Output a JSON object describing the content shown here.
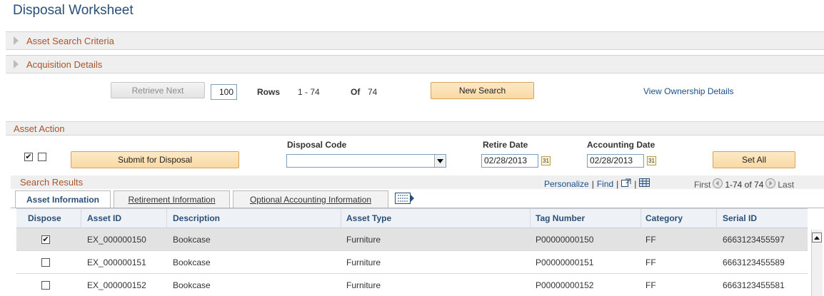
{
  "page": {
    "title": "Disposal Worksheet"
  },
  "sections": {
    "asset_search_criteria": "Asset Search Criteria",
    "acquisition_details": "Acquisition Details",
    "asset_action": "Asset Action"
  },
  "nav": {
    "retrieve_next": "Retrieve Next",
    "rows_value": "100",
    "rows_label": "Rows",
    "range_text": "1 - 74",
    "of_label": "Of",
    "of_value": "74",
    "new_search": "New Search",
    "view_ownership": "View Ownership Details"
  },
  "asset_action": {
    "check_all": "✔",
    "submit": "Submit for Disposal",
    "disposal_code_label": "Disposal Code",
    "disposal_code_value": "",
    "retire_date_label": "Retire Date",
    "retire_date_value": "02/28/2013",
    "accounting_date_label": "Accounting Date",
    "accounting_date_value": "02/28/2013",
    "set_all": "Set All",
    "calendar_glyph": "31"
  },
  "results": {
    "title": "Search Results",
    "personalize": "Personalize",
    "find": "Find",
    "pipe": "|",
    "first": "First",
    "range": "1-74 of 74",
    "last": "Last",
    "tabs": [
      "Asset Information",
      "Retirement Information",
      "Optional Accounting Information"
    ],
    "columns": [
      "Dispose",
      "Asset ID",
      "Description",
      "Asset Type",
      "Tag Number",
      "Category",
      "Serial ID"
    ],
    "rows": [
      {
        "dispose": "✔",
        "asset_id": "EX_000000150",
        "description": "Bookcase",
        "asset_type": "Furniture",
        "tag": "P00000000150",
        "category": "FF",
        "serial": "6663123455597"
      },
      {
        "dispose": "",
        "asset_id": "EX_000000151",
        "description": "Bookcase",
        "asset_type": "Furniture",
        "tag": "P00000000151",
        "category": "FF",
        "serial": "6663123455589"
      },
      {
        "dispose": "",
        "asset_id": "EX_000000152",
        "description": "Bookcase",
        "asset_type": "Furniture",
        "tag": "P00000000152",
        "category": "FF",
        "serial": "6663123455581"
      }
    ]
  }
}
